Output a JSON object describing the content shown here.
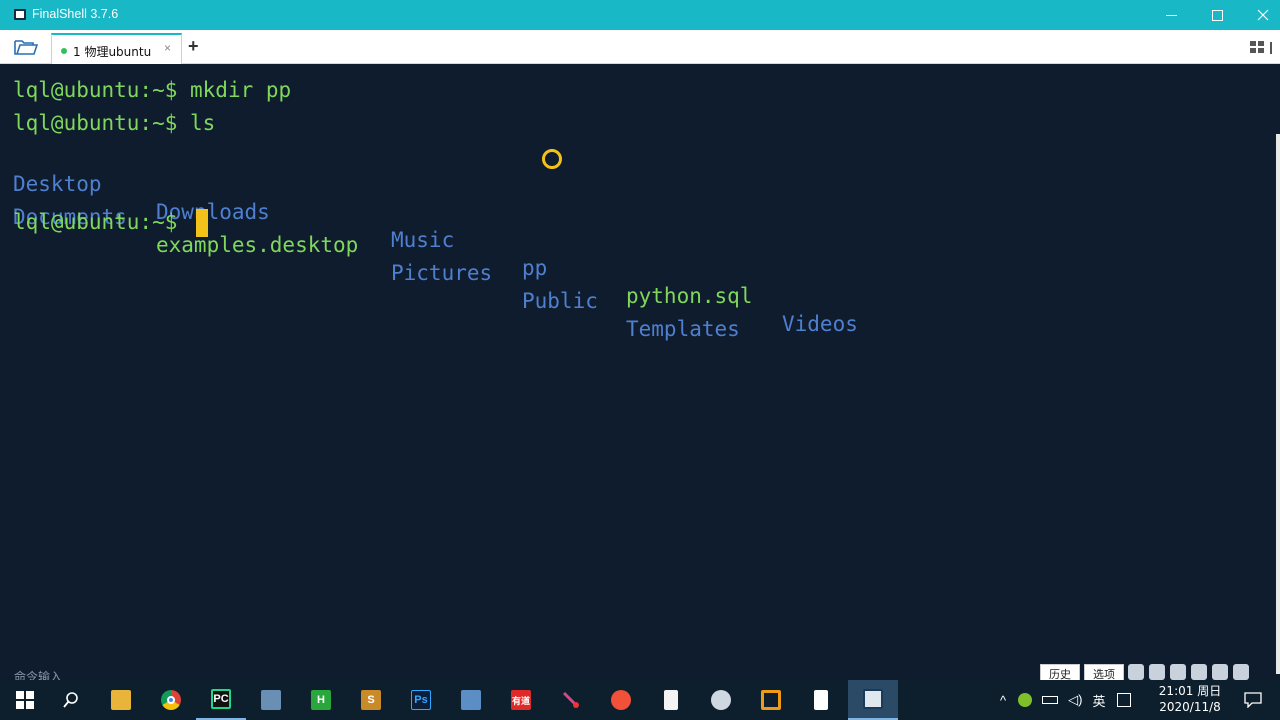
{
  "window": {
    "title": "FinalShell 3.7.6"
  },
  "tabs": [
    {
      "label": "1 物理ubuntu",
      "close": "×"
    }
  ],
  "add_tab_label": "+",
  "terminal": {
    "lines": [
      {
        "prompt": "lql@ubuntu:~$",
        "command": " mkdir pp"
      },
      {
        "prompt": "lql@ubuntu:~$",
        "command": " ls"
      },
      {
        "prompt": "lql@ubuntu:~$",
        "command": ""
      }
    ],
    "ls_row1": [
      {
        "name": "Desktop",
        "kind": "dir"
      },
      {
        "name": "Downloads",
        "kind": "dir"
      },
      {
        "name": "Music",
        "kind": "dir"
      },
      {
        "name": "pp",
        "kind": "dir"
      },
      {
        "name": "python.sql",
        "kind": "file"
      },
      {
        "name": "Videos",
        "kind": "dir"
      }
    ],
    "ls_row2": [
      {
        "name": "Documents",
        "kind": "dir"
      },
      {
        "name": "examples.desktop",
        "kind": "file"
      },
      {
        "name": "Pictures",
        "kind": "dir"
      },
      {
        "name": "Public",
        "kind": "dir"
      },
      {
        "name": "Templates",
        "kind": "dir"
      }
    ],
    "colors": {
      "background": "#0f1c2e",
      "prompt": "#7fd85a",
      "directory": "#4f7fcf",
      "file": "#7fd85a",
      "cursor": "#f2c21b"
    }
  },
  "footer": {
    "command_input_label": "命令输入",
    "history_button": "历史",
    "options_button": "选项"
  },
  "taskbar": {
    "apps": [
      {
        "icon": "windows-start-icon"
      },
      {
        "icon": "search-icon"
      },
      {
        "icon": "file-explorer-icon"
      },
      {
        "icon": "chrome-icon"
      },
      {
        "icon": "pycharm-icon",
        "label": "PC"
      },
      {
        "icon": "remote-desktop-icon"
      },
      {
        "icon": "hbuilder-icon",
        "label": "H"
      },
      {
        "icon": "sublime-icon",
        "label": "S"
      },
      {
        "icon": "photoshop-icon",
        "label": "Ps"
      },
      {
        "icon": "calculator-icon"
      },
      {
        "icon": "youdao-icon",
        "label": "有道"
      },
      {
        "icon": "pen-tool-icon"
      },
      {
        "icon": "swift-icon"
      },
      {
        "icon": "document-icon"
      },
      {
        "icon": "paint-icon"
      },
      {
        "icon": "vmware-icon"
      },
      {
        "icon": "notepad-icon"
      },
      {
        "icon": "finalshell-icon"
      }
    ],
    "tray": {
      "ime_label": "英",
      "time": "21:01 周日",
      "date": "2020/11/8"
    }
  }
}
